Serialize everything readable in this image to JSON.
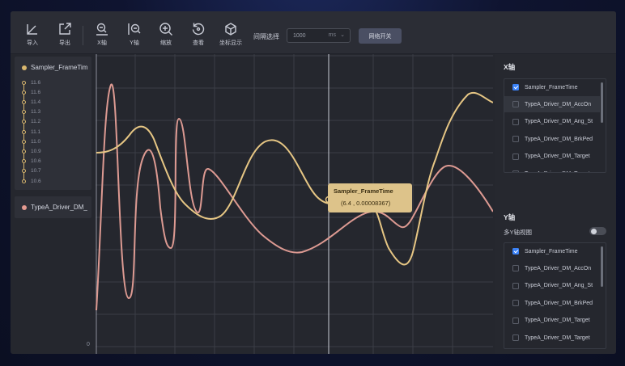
{
  "toolbar": {
    "buttons": [
      {
        "label": "导入",
        "icon": "import-icon"
      },
      {
        "label": "导出",
        "icon": "export-icon"
      },
      {
        "label": "X轴",
        "icon": "x-axis-icon"
      },
      {
        "label": "Y轴",
        "icon": "y-axis-icon"
      },
      {
        "label": "缩放",
        "icon": "zoom-icon"
      },
      {
        "label": "查看",
        "icon": "reset-view-icon"
      },
      {
        "label": "坐标显示",
        "icon": "coordinate-display-icon"
      }
    ],
    "interval_label": "间隔选择",
    "interval_value": "1000",
    "interval_unit": "ms",
    "grid_toggle_label": "网络开关"
  },
  "legend": {
    "series1": {
      "name": "Sampler_FrameTim",
      "color": "#d9b76e",
      "values": [
        "11.6",
        "11.6",
        "11.4",
        "11.3",
        "11.2",
        "11.1",
        "11.0",
        "10.9",
        "10.6",
        "10.7",
        "10.6"
      ]
    },
    "series2": {
      "name": "TypeA_Driver_DM_",
      "color": "#e39a90"
    }
  },
  "chart": {
    "zero_label": "0",
    "tooltip_series": "Sampler_FrameTime",
    "tooltip_value": "(6.4 , 0.00008367)",
    "line_colors": {
      "series1": "#e6c684",
      "series2": "#dd9a92"
    }
  },
  "x_axis_panel": {
    "title": "X轴",
    "items": [
      {
        "label": "Sampler_FrameTime",
        "checked": true
      },
      {
        "label": "TypeA_Driver_DM_AccOn",
        "checked": false
      },
      {
        "label": "TypeA_Driver_DM_Ang_St",
        "checked": false
      },
      {
        "label": "TypeA_Driver_DM_BrkPed",
        "checked": false
      },
      {
        "label": "TypeA_Driver_DM_Target",
        "checked": false
      },
      {
        "label": "TypeA_Driver_DM_Target",
        "checked": false
      }
    ]
  },
  "y_axis_panel": {
    "title": "Y轴",
    "multi_y_label": "多Y轴视图",
    "items": [
      {
        "label": "Sampler_FrameTime",
        "checked": true
      },
      {
        "label": "TypeA_Driver_DM_AccOn",
        "checked": false
      },
      {
        "label": "TypeA_Driver_DM_Ang_St",
        "checked": false
      },
      {
        "label": "TypeA_Driver_DM_BrkPed",
        "checked": false
      },
      {
        "label": "TypeA_Driver_DM_Target",
        "checked": false
      },
      {
        "label": "TypeA_Driver_DM_Target",
        "checked": false
      }
    ]
  }
}
